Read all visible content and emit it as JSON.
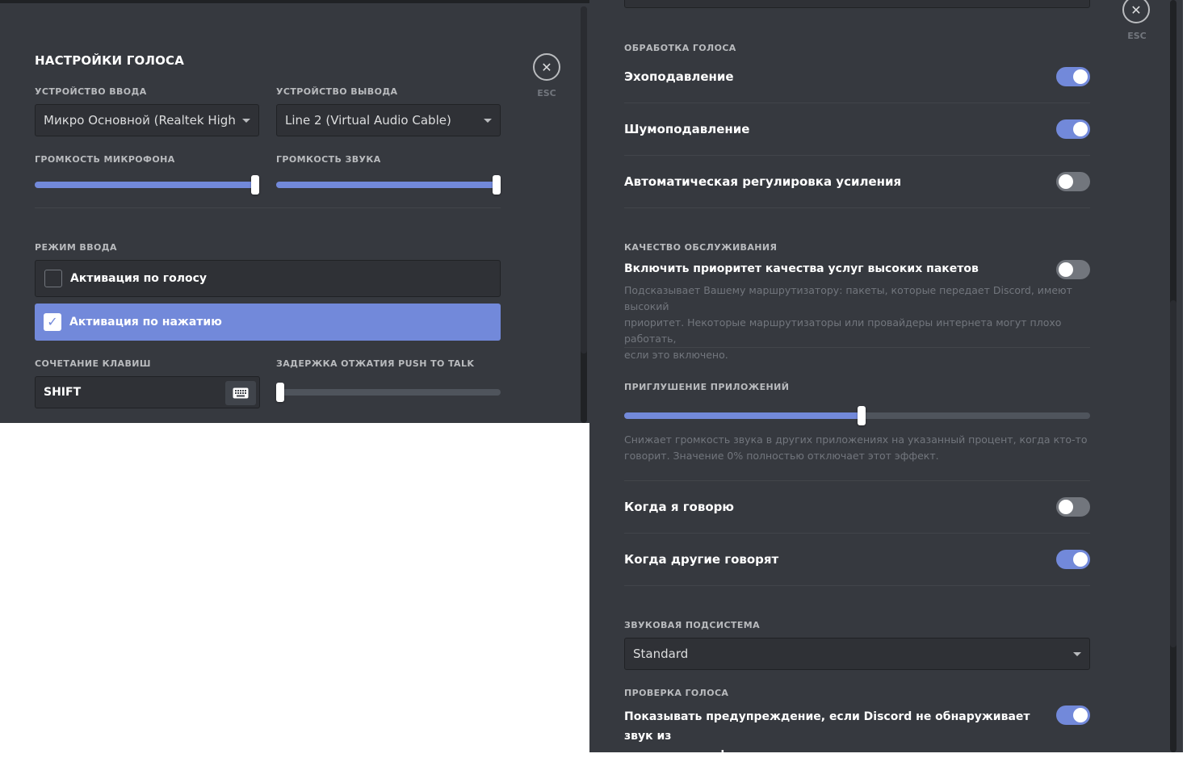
{
  "left": {
    "title": "НАСТРОЙКИ ГОЛОСА",
    "close_label": "ESC",
    "input_device": {
      "label": "УСТРОЙСТВО ВВОДА",
      "value": "Микро Основной (Realtek High D..."
    },
    "output_device": {
      "label": "УСТРОЙСТВО ВЫВОДА",
      "value": "Line 2 (Virtual Audio Cable)"
    },
    "mic_volume": {
      "label": "ГРОМКОСТЬ МИКРОФОНА",
      "percent": 100
    },
    "sound_volume": {
      "label": "ГРОМКОСТЬ ЗВУКА",
      "percent": 100
    },
    "input_mode": {
      "label": "РЕЖИМ ВВОДА",
      "options": [
        {
          "label": "Активация по голосу",
          "selected": false
        },
        {
          "label": "Активация по нажатию",
          "selected": true
        }
      ]
    },
    "shortcut": {
      "label": "СОЧЕТАНИЕ КЛАВИШ",
      "value": "SHIFT"
    },
    "ptt_delay": {
      "label": "ЗАДЕРЖКА ОТЖАТИЯ PUSH TO TALK",
      "percent": 0
    }
  },
  "right": {
    "close_label": "ESC",
    "voice_processing": {
      "label": "ОБРАБОТКА ГОЛОСА",
      "items": [
        {
          "label": "Эхоподавление",
          "on": true
        },
        {
          "label": "Шумоподавление",
          "on": true
        },
        {
          "label": "Автоматическая регулировка усиления",
          "on": false
        }
      ]
    },
    "qos": {
      "label": "КАЧЕСТВО ОБСЛУЖИВАНИЯ",
      "item_label": "Включить приоритет качества услуг высоких пакетов",
      "on": false,
      "desc_lines": [
        "Подсказывает Вашему маршрутизатору: пакеты, которые передает Discord, имеют высокий",
        "приоритет. Некоторые маршрутизаторы или провайдеры интернета могут плохо работать,",
        "если это включено."
      ]
    },
    "attenuation": {
      "label": "ПРИГЛУШЕНИЕ ПРИЛОЖЕНИЙ",
      "percent": 51,
      "desc_lines": [
        "Снижает громкость звука в других приложениях на указанный процент, когда кто-то",
        "говорит. Значение 0% полностью отключает этот эффект."
      ],
      "items": [
        {
          "label": "Когда я говорю",
          "on": false
        },
        {
          "label": "Когда другие говорят",
          "on": true
        }
      ]
    },
    "audio_subsystem": {
      "label": "ЗВУКОВАЯ ПОДСИСТЕМА",
      "value": "Standard"
    },
    "voice_check": {
      "label": "ПРОВЕРКА ГОЛОСА",
      "line1": "Показывать предупреждение, если Discord не обнаруживает звук из",
      "line2": "вашего микрофона.",
      "on": true
    }
  },
  "colors": {
    "accent": "#7289da",
    "background": "#36393f",
    "input_bg": "#2f3136"
  }
}
